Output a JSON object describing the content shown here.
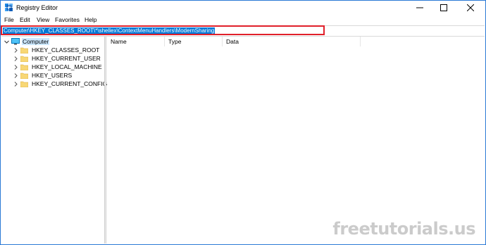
{
  "window": {
    "title": "Registry Editor",
    "accent_color": "#2b79d6",
    "controls": [
      "minimize-icon",
      "maximize-icon",
      "close-icon"
    ]
  },
  "menu": [
    "File",
    "Edit",
    "View",
    "Favorites",
    "Help"
  ],
  "address": {
    "path": "Computer\\HKEY_CLASSES_ROOT\\*\\shellex\\ContextMenuHandlers\\ModernSharing",
    "selection_color": "#0078d7",
    "highlight_color": "#e0202a"
  },
  "tree": {
    "root": {
      "label": "Computer",
      "icon": "computer-icon",
      "expanded": true
    },
    "hives": [
      {
        "label": "HKEY_CLASSES_ROOT",
        "icon": "folder-icon"
      },
      {
        "label": "HKEY_CURRENT_USER",
        "icon": "folder-icon"
      },
      {
        "label": "HKEY_LOCAL_MACHINE",
        "icon": "folder-icon"
      },
      {
        "label": "HKEY_USERS",
        "icon": "folder-icon"
      },
      {
        "label": "HKEY_CURRENT_CONFIG",
        "icon": "folder-icon"
      }
    ]
  },
  "list": {
    "columns": [
      "Name",
      "Type",
      "Data"
    ]
  },
  "watermark": "freetutorials.us"
}
